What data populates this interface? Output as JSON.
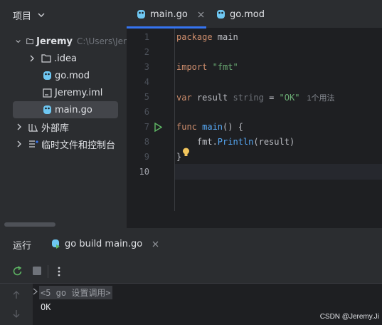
{
  "project_panel": {
    "title": "项目",
    "tree": [
      {
        "label": "Jeremy",
        "path": "C:\\Users\\Jer"
      },
      {
        "label": ".idea"
      },
      {
        "label": "go.mod"
      },
      {
        "label": "Jeremy.iml"
      },
      {
        "label": "main.go"
      },
      {
        "label": "外部库"
      },
      {
        "label": "临时文件和控制台"
      }
    ]
  },
  "editor": {
    "tabs": [
      {
        "label": "main.go",
        "active": true
      },
      {
        "label": "go.mod",
        "active": false
      }
    ],
    "line_numbers": [
      "1",
      "2",
      "3",
      "4",
      "5",
      "6",
      "7",
      "8",
      "9",
      "10"
    ],
    "code": {
      "l1_kw": "package",
      "l1_rest": " main",
      "l3_kw": "import",
      "l3_str": "\"fmt\"",
      "l5_kw": "var",
      "l5_name": " result ",
      "l5_type": "string",
      "l5_eq": " = ",
      "l5_str": "\"OK\"",
      "l5_hint": "1个用法",
      "l7_kw": "func",
      "l7_fn": " main",
      "l7_rest": "() {",
      "l8_indent": "    fmt.",
      "l8_fn": "Println",
      "l8_rest": "(result)",
      "l9": "}"
    }
  },
  "run_panel": {
    "title": "运行",
    "tab_label": "go build main.go",
    "console_cmd": "<5 go 设置调用>",
    "console_output": "OK"
  },
  "watermark": "CSDN @Jeremy.Ji",
  "colors": {
    "accent": "#3574f0",
    "run_green": "#5fb865",
    "bulb_yellow": "#f2c55c",
    "go_blue": "#6ec7f2"
  }
}
